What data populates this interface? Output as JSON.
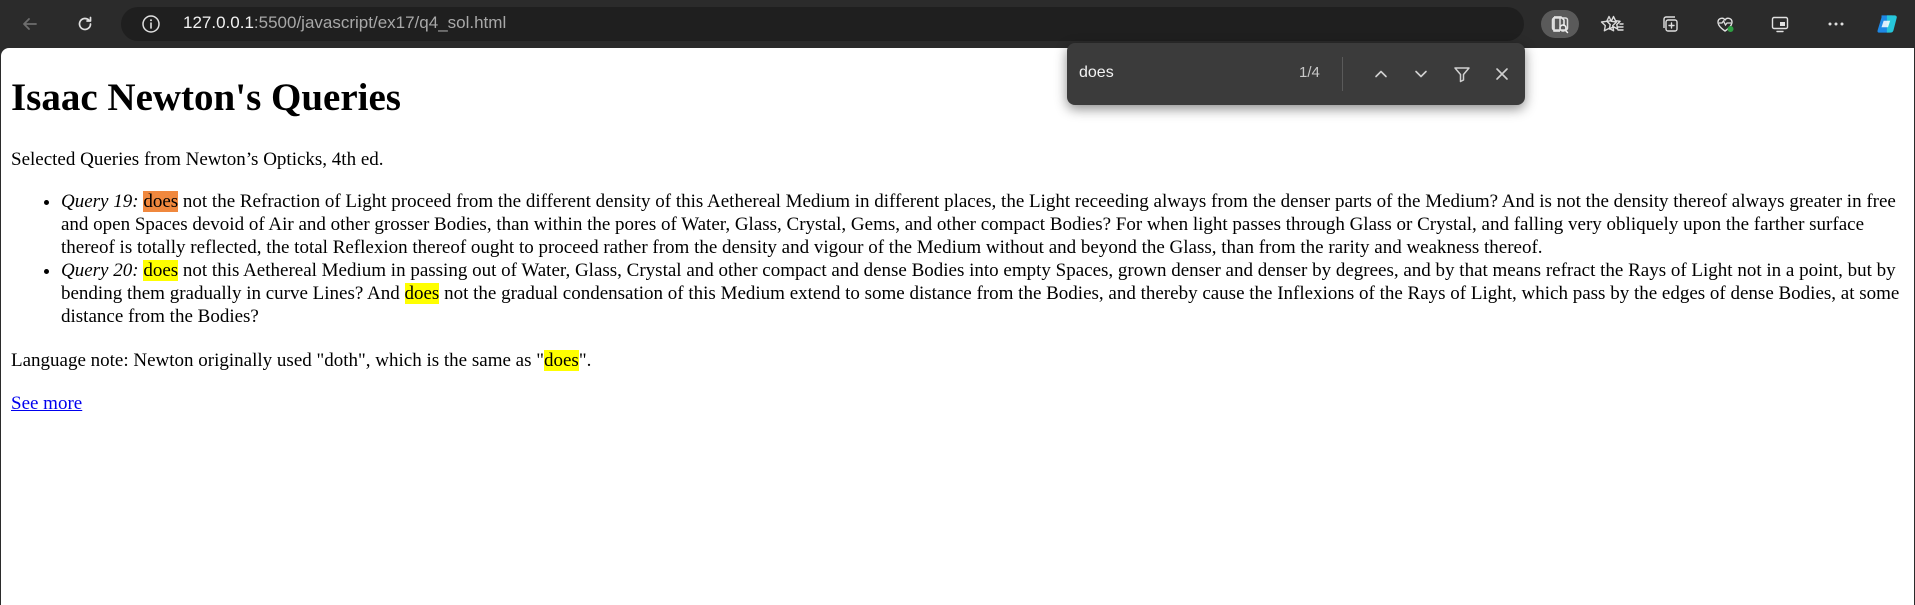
{
  "browser": {
    "url_host": "127.0.0.1",
    "url_rest": ":5500/javascript/ex17/q4_sol.html"
  },
  "find": {
    "query": "does",
    "count": "1/4"
  },
  "page": {
    "title": "Isaac Newton's Queries",
    "intro": "Selected Queries from Newton’s Opticks, 4th ed.",
    "queries": [
      {
        "label": "Query 19:",
        "match": "does",
        "text": " not the Refraction of Light proceed from the different density of this Aethereal Medium in different places, the Light receeding always from the denser parts of the Medium? And is not the density thereof always greater in free and open Spaces devoid of Air and other grosser Bodies, than within the pores of Water, Glass, Crystal, Gems, and other compact Bodies? For when light passes through Glass or Crystal, and falling very obliquely upon the farther surface thereof is totally reflected, the total Reflexion thereof ought to proceed rather from the density and vigour of the Medium without and beyond the Glass, than from the rarity and weakness thereof."
      },
      {
        "label": "Query 20:",
        "match": "does",
        "text_a": " not this Aethereal Medium in passing out of Water, Glass, Crystal and other compact and dense Bodies into empty Spaces, grown denser and denser by degrees, and by that means refract the Rays of Light not in a point, but by bending them gradually in curve Lines? And ",
        "match2": "does",
        "text_b": " not the gradual condensation of this Medium extend to some distance from the Bodies, and thereby cause the Inflexions of the Rays of Light, which pass by the edges of dense Bodies, at some distance from the Bodies?"
      }
    ],
    "note_before": "Language note: Newton originally used \"doth\", which is the same as \"",
    "note_match": "does",
    "note_after": "\".",
    "see_more": "See more"
  },
  "colors": {
    "highlight": "#ffff00",
    "current_highlight": "#f0883e",
    "link": "#0000ee"
  }
}
